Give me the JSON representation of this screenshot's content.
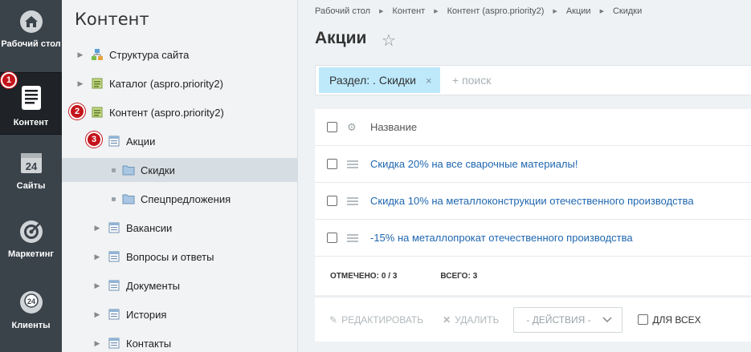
{
  "appbar": {
    "items": [
      {
        "label": "Рабочий стол",
        "icon": "home-icon"
      },
      {
        "label": "Контент",
        "icon": "document-icon",
        "active": true
      },
      {
        "label": "Сайты",
        "icon": "calendar-24-icon"
      },
      {
        "label": "Маркетинг",
        "icon": "target-icon"
      },
      {
        "label": "Клиенты",
        "icon": "clients-24-icon"
      }
    ]
  },
  "badges": [
    "1",
    "2",
    "3"
  ],
  "tree": {
    "title": "Контент",
    "items": [
      {
        "label": "Структура сайта",
        "icon": "site-structure-icon"
      },
      {
        "label": "Каталог (aspro.priority2)",
        "icon": "infoblock-type-icon"
      },
      {
        "label": "Контент (aspro.priority2)",
        "icon": "infoblock-type-icon"
      },
      {
        "label": "Акции",
        "icon": "infoblock-icon"
      },
      {
        "label": "Скидки",
        "icon": "folder-icon",
        "selected": true
      },
      {
        "label": "Спецпредложения",
        "icon": "folder-icon"
      },
      {
        "label": "Вакансии",
        "icon": "infoblock-icon"
      },
      {
        "label": "Вопросы и ответы",
        "icon": "infoblock-icon"
      },
      {
        "label": "Документы",
        "icon": "infoblock-icon"
      },
      {
        "label": "История",
        "icon": "infoblock-icon"
      },
      {
        "label": "Контакты",
        "icon": "infoblock-icon"
      }
    ]
  },
  "breadcrumbs": [
    "Рабочий стол",
    "Контент",
    "Контент (aspro.priority2)",
    "Акции",
    "Скидки"
  ],
  "page": {
    "title": "Акции"
  },
  "filter": {
    "chip_label": "Раздел: . Скидки",
    "chip_close": "×",
    "search_placeholder": "+ поиск"
  },
  "grid": {
    "header": "Название",
    "rows": [
      "Скидка 20% на все сварочные материалы!",
      "Скидка 10% на металлоконструкции отечественного производства",
      "-15% на металлопрокат отечественного производства"
    ],
    "footer": {
      "checked_label": "ОТМЕЧЕНО:",
      "checked_value": "0 / 3",
      "total_label": "ВСЕГО:",
      "total_value": "3"
    }
  },
  "actions": {
    "edit": "РЕДАКТИРОВАТЬ",
    "delete": "УДАЛИТЬ",
    "select_value": "- ДЕЙСТВИЯ -",
    "for_all": "ДЛЯ ВСЕХ"
  },
  "colors": {
    "appbar": "#3a424a",
    "link": "#2067b0",
    "chip": "#bde9fb",
    "badge": "#c4141b"
  }
}
